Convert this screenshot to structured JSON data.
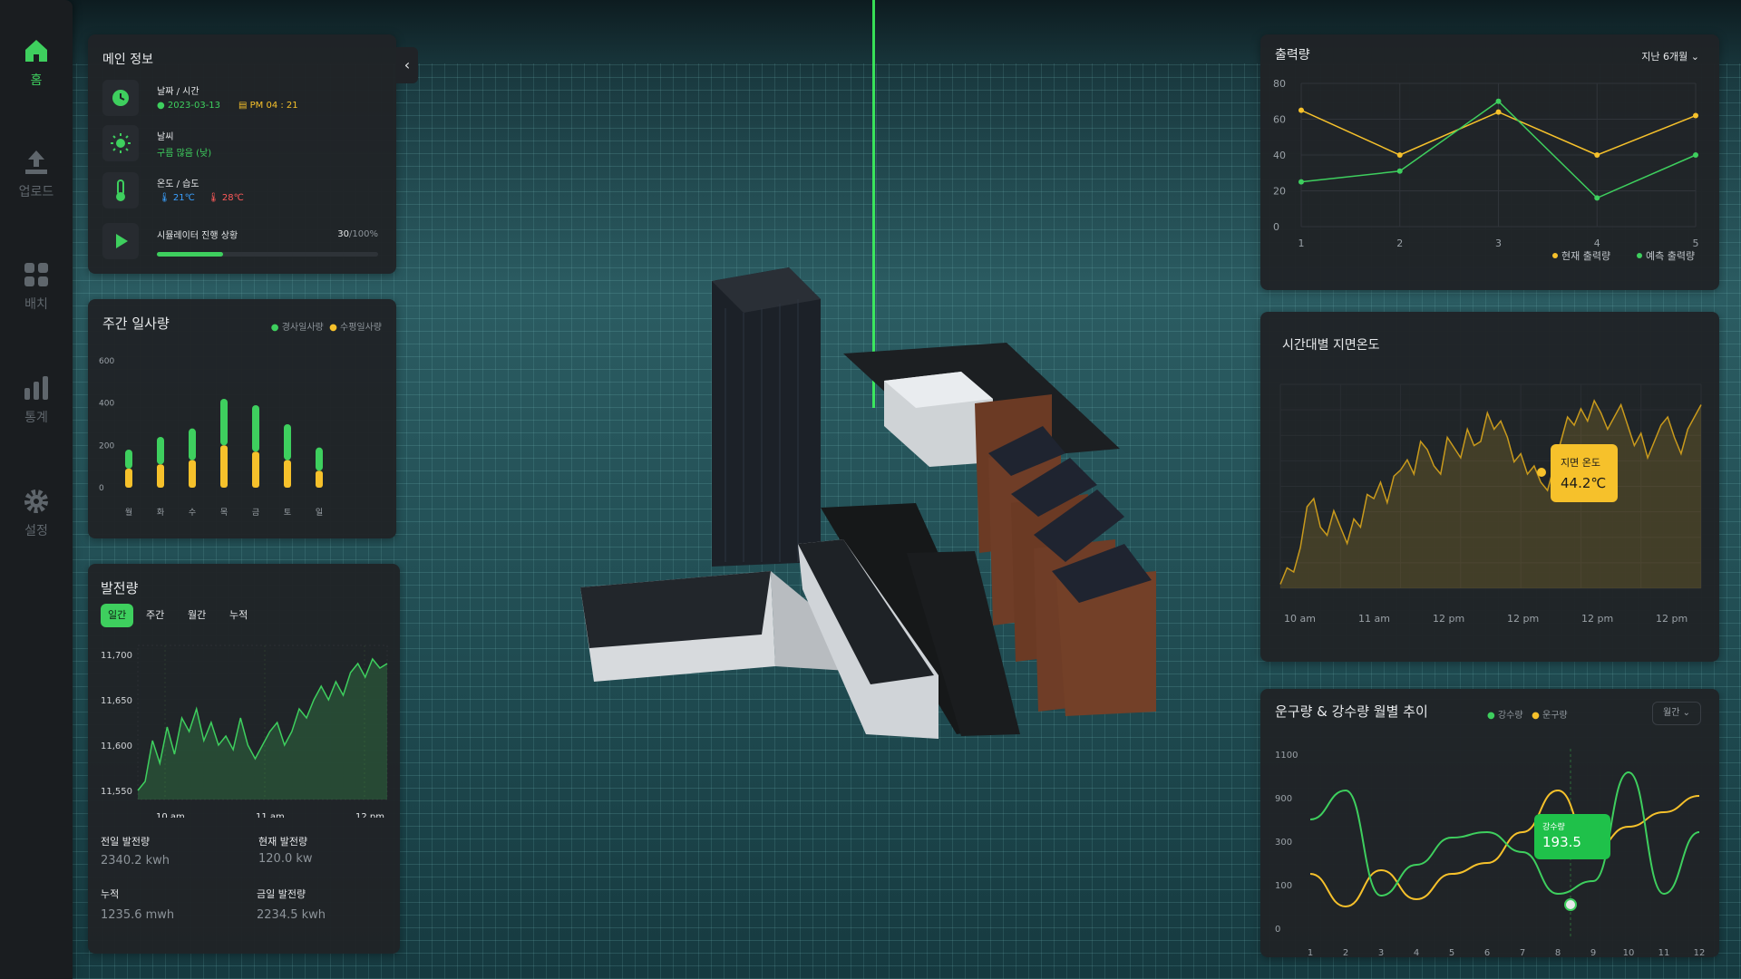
{
  "sidebar": {
    "items": [
      {
        "label": "홈",
        "icon": "home-icon",
        "active": true
      },
      {
        "label": "업로드",
        "icon": "upload-icon",
        "active": false
      },
      {
        "label": "배치",
        "icon": "grid-icon",
        "active": false
      },
      {
        "label": "통계",
        "icon": "bar-chart-icon",
        "active": false
      },
      {
        "label": "설정",
        "icon": "gear-icon",
        "active": false
      }
    ]
  },
  "main_info": {
    "title": "메인 정보",
    "datetime_label": "날짜 / 시간",
    "date": "2023-03-13",
    "time": "PM 04 : 21",
    "weather_label": "날씨",
    "weather_value": "구름 많음 (낮)",
    "temp_label": "온도 / 습도",
    "temp_low": "21℃",
    "temp_high": "28℃",
    "sim_label": "시뮬레이터 진행 상황",
    "sim_progress_value": "30",
    "sim_progress_total": "/100%",
    "sim_progress": 0.3
  },
  "weekly": {
    "title": "주간 일사량",
    "legend_green": "경사일사량",
    "legend_yellow": "수평일사량"
  },
  "generation": {
    "title": "발전량",
    "tabs": [
      "일간",
      "주간",
      "월간",
      "누적"
    ],
    "stats": [
      {
        "label": "전일 발전량",
        "value": "2340.2 kwh"
      },
      {
        "label": "현재 발전량",
        "value": "120.0 kw"
      },
      {
        "label": "누적",
        "value": "1235.6 mwh"
      },
      {
        "label": "금일 발전량",
        "value": "2234.5 kwh"
      }
    ]
  },
  "output": {
    "title": "출력량",
    "period": "지난 6개월"
  },
  "ground_temp": {
    "title": "시간대별 지면온도",
    "tooltip_label": "지면 온도",
    "tooltip_value": "44.2℃"
  },
  "cloud_rain": {
    "title": "운구량 & 강수량 월별 추이",
    "legend_green": "강수량",
    "legend_yellow": "운구량",
    "select": "월간",
    "tooltip_label": "강수량",
    "tooltip_value": "193.5"
  },
  "colors": {
    "green": "#3ecf5e",
    "yellow": "#f6c12b",
    "panel": "#202327"
  },
  "chart_data": [
    {
      "type": "bar",
      "title": "주간 일사량",
      "categories": [
        "월",
        "화",
        "수",
        "목",
        "금",
        "토",
        "일"
      ],
      "yticks": [
        "0",
        "200",
        "400",
        "600"
      ],
      "ylim": [
        0,
        600
      ],
      "series": [
        {
          "name": "경사일사량",
          "values": [
            90,
            130,
            150,
            220,
            220,
            170,
            110
          ]
        },
        {
          "name": "수평일사량",
          "values": [
            90,
            110,
            130,
            200,
            170,
            130,
            80
          ]
        }
      ]
    },
    {
      "type": "area",
      "title": "발전량",
      "xticks": [
        "10 am",
        "11 am",
        "12 pm"
      ],
      "yticks": [
        "11,700",
        "11,650",
        "11,600",
        "11,550"
      ],
      "ylim": [
        11540,
        11710
      ],
      "values": [
        11550,
        11560,
        11605,
        11580,
        11620,
        11590,
        11630,
        11615,
        11640,
        11605,
        11625,
        11600,
        11610,
        11595,
        11630,
        11600,
        11585,
        11600,
        11615,
        11625,
        11600,
        11615,
        11640,
        11630,
        11650,
        11665,
        11650,
        11670,
        11655,
        11680,
        11690,
        11675,
        11695,
        11685,
        11690
      ]
    },
    {
      "type": "line",
      "title": "출력량",
      "x": [
        1,
        2,
        3,
        4,
        5
      ],
      "xticks": [
        "1",
        "2",
        "3",
        "4",
        "5"
      ],
      "yticks": [
        "0",
        "20",
        "40",
        "60",
        "80"
      ],
      "ylim": [
        0,
        80
      ],
      "legend": "bottom-right",
      "series": [
        {
          "name": "현재 출력량",
          "values": [
            65,
            40,
            64,
            40,
            62
          ]
        },
        {
          "name": "예측 출력량",
          "values": [
            25,
            31,
            70,
            16,
            40
          ]
        }
      ]
    },
    {
      "type": "area",
      "title": "시간대별 지면온도",
      "xticks": [
        "10 am",
        "11 am",
        "12 pm",
        "12 pm",
        "12 pm",
        "12 pm"
      ],
      "values": [
        2,
        10,
        8,
        20,
        40,
        44,
        30,
        26,
        38,
        30,
        22,
        34,
        30,
        46,
        44,
        52,
        42,
        55,
        58,
        63,
        56,
        72,
        68,
        60,
        56,
        74,
        69,
        64,
        78,
        70,
        72,
        86,
        78,
        82,
        74,
        62,
        66,
        56,
        60,
        52,
        48,
        60,
        72,
        84,
        80,
        88,
        82,
        92,
        86,
        78,
        84,
        90,
        80,
        70,
        76,
        64,
        72,
        80,
        84,
        74,
        66,
        78,
        84,
        90
      ]
    },
    {
      "type": "line",
      "title": "운구량 & 강수량 월별 추이",
      "x": [
        1,
        2,
        3,
        4,
        5,
        6,
        7,
        8,
        9,
        10,
        11,
        12
      ],
      "xticks": [
        "1",
        "2",
        "3",
        "4",
        "5",
        "6",
        "7",
        "8",
        "9",
        "10",
        "11",
        "12"
      ],
      "yticks": [
        "0",
        "100",
        "300",
        "900",
        "1100"
      ],
      "series": [
        {
          "name": "강수량",
          "values": [
            560,
            720,
            140,
            310,
            460,
            490,
            380,
            150,
            220,
            820,
            150,
            490
          ]
        },
        {
          "name": "운구량",
          "values": [
            260,
            80,
            280,
            120,
            260,
            320,
            490,
            720,
            390,
            520,
            600,
            690
          ]
        }
      ]
    }
  ]
}
